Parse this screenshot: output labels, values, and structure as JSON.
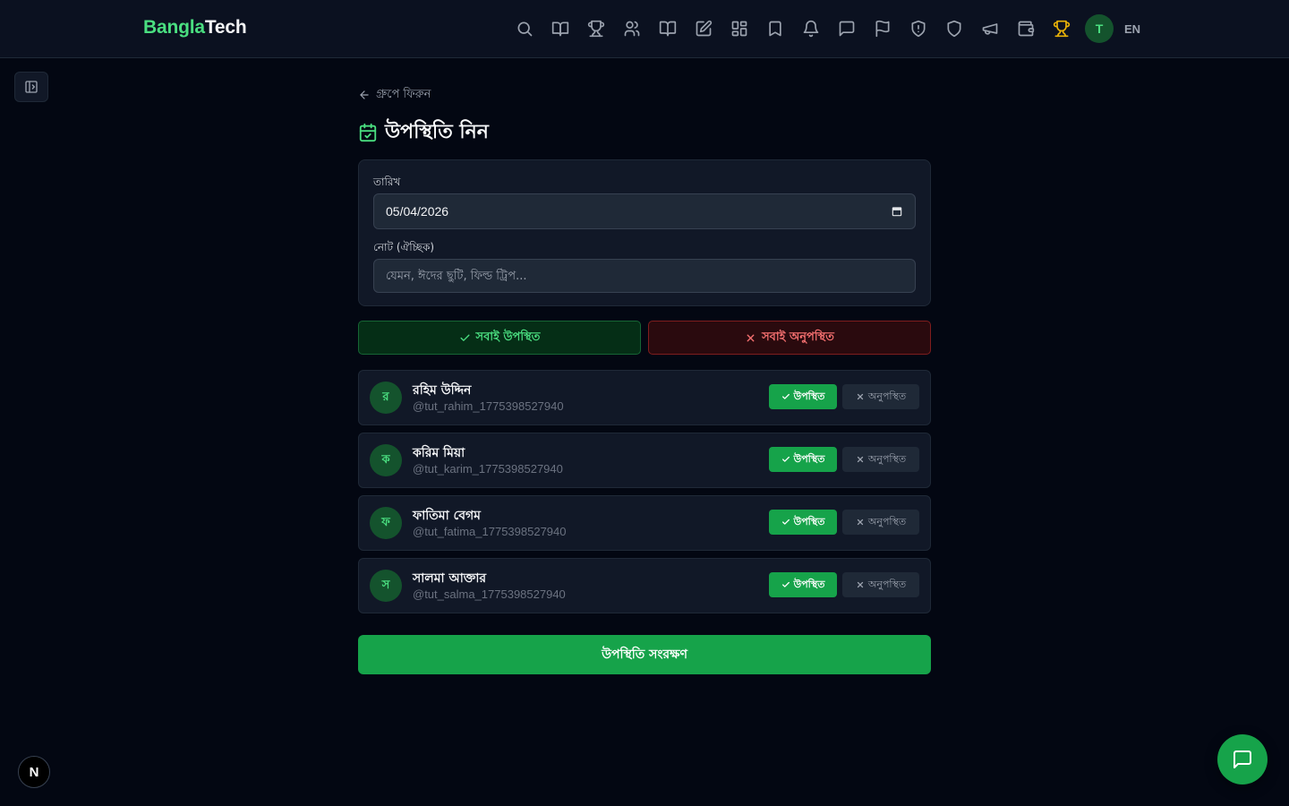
{
  "brand": {
    "part1": "Bangla",
    "part2": "Tech"
  },
  "nav": {
    "icons": [
      "search-icon",
      "book-open-icon",
      "trophy-icon",
      "users-icon",
      "book-icon",
      "edit-icon",
      "grid-icon",
      "bookmark-icon",
      "bell-icon",
      "message-icon",
      "flag-icon",
      "shield-alert-icon",
      "shield-icon",
      "megaphone-icon",
      "wallet-icon",
      "trophy-gold-icon"
    ],
    "user_initial": "T",
    "language": "EN"
  },
  "page": {
    "back_label": "গ্রুপে ফিরুন",
    "title": "উপস্থিতি নিন"
  },
  "form": {
    "date_label": "তারিখ",
    "date_value": "05/04/2026",
    "note_label": "নোট (ঐচ্ছিক)",
    "note_placeholder": "যেমন, ঈদের ছুটি, ফিল্ড ট্রিপ..."
  },
  "bulk": {
    "all_present": "সবাই উপস্থিত",
    "all_absent": "সবাই অনুপস্থিত"
  },
  "students": [
    {
      "initial": "র",
      "name": "রহিম উদ্দিন",
      "handle": "@tut_rahim_1775398527940",
      "status": "present"
    },
    {
      "initial": "ক",
      "name": "করিম মিয়া",
      "handle": "@tut_karim_1775398527940",
      "status": "present"
    },
    {
      "initial": "ফ",
      "name": "ফাতিমা বেগম",
      "handle": "@tut_fatima_1775398527940",
      "status": "present"
    },
    {
      "initial": "স",
      "name": "সালমা আক্তার",
      "handle": "@tut_salma_1775398527940",
      "status": "present"
    }
  ],
  "status_labels": {
    "present": "উপস্থিত",
    "absent": "অনুপস্থিত"
  },
  "save_label": "উপস্থিতি সংরক্ষণ",
  "floating": {
    "dev_badge": "N"
  },
  "colors": {
    "accent": "#16a34a",
    "accent_text": "#4ade80",
    "danger": "#f87171",
    "background": "#030712",
    "card": "#111827",
    "gold": "#eab308"
  }
}
